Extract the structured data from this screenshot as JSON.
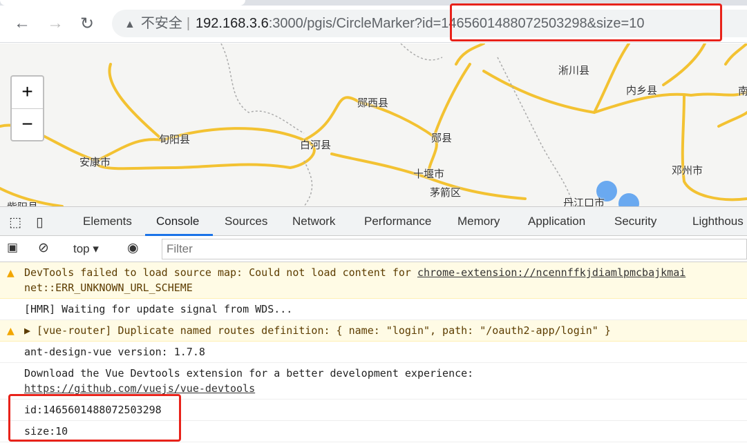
{
  "browser": {
    "security_label": "不安全",
    "url_host": "192.168.3.6",
    "url_rest": ":3000/pgis/CircleMarker",
    "url_query": "?id=1465601488072503298&size=10",
    "highlight_color": "#e8221a"
  },
  "map": {
    "zoom_in": "+",
    "zoom_out": "−",
    "road_color": "#f3c232",
    "marker_color": "#6aa9f0",
    "labels": [
      "淅川县",
      "内乡县",
      "郧西县",
      "旬阳县",
      "白河县",
      "郧县",
      "十堰市",
      "茅箭区",
      "安康市",
      "邓州市",
      "丹江口市",
      "南",
      "紫阳县"
    ]
  },
  "devtools": {
    "tabs": [
      "Elements",
      "Console",
      "Sources",
      "Network",
      "Performance",
      "Memory",
      "Application",
      "Security",
      "Lighthous"
    ],
    "active_tab": "Console",
    "context": "top",
    "filter_placeholder": "Filter",
    "messages": [
      {
        "level": "warning",
        "text": "DevTools failed to load source map: Could not load content for ",
        "link": "chrome-extension://ncennffkjdiamlpmcbajkmai",
        "text2": "net::ERR_UNKNOWN_URL_SCHEME"
      },
      {
        "level": "info",
        "text": "[HMR] Waiting for update signal from WDS..."
      },
      {
        "level": "warning",
        "text": "▶ [vue-router] Duplicate named routes definition: { name: \"login\", path: \"/oauth2-app/login\" }"
      },
      {
        "level": "info",
        "text": "ant-design-vue version: 1.7.8"
      },
      {
        "level": "info",
        "text": "Download the Vue Devtools extension for a better development experience:",
        "link": "https://github.com/vuejs/vue-devtools"
      },
      {
        "level": "info",
        "text": "id:1465601488072503298"
      },
      {
        "level": "info",
        "text": "size:10"
      }
    ]
  }
}
